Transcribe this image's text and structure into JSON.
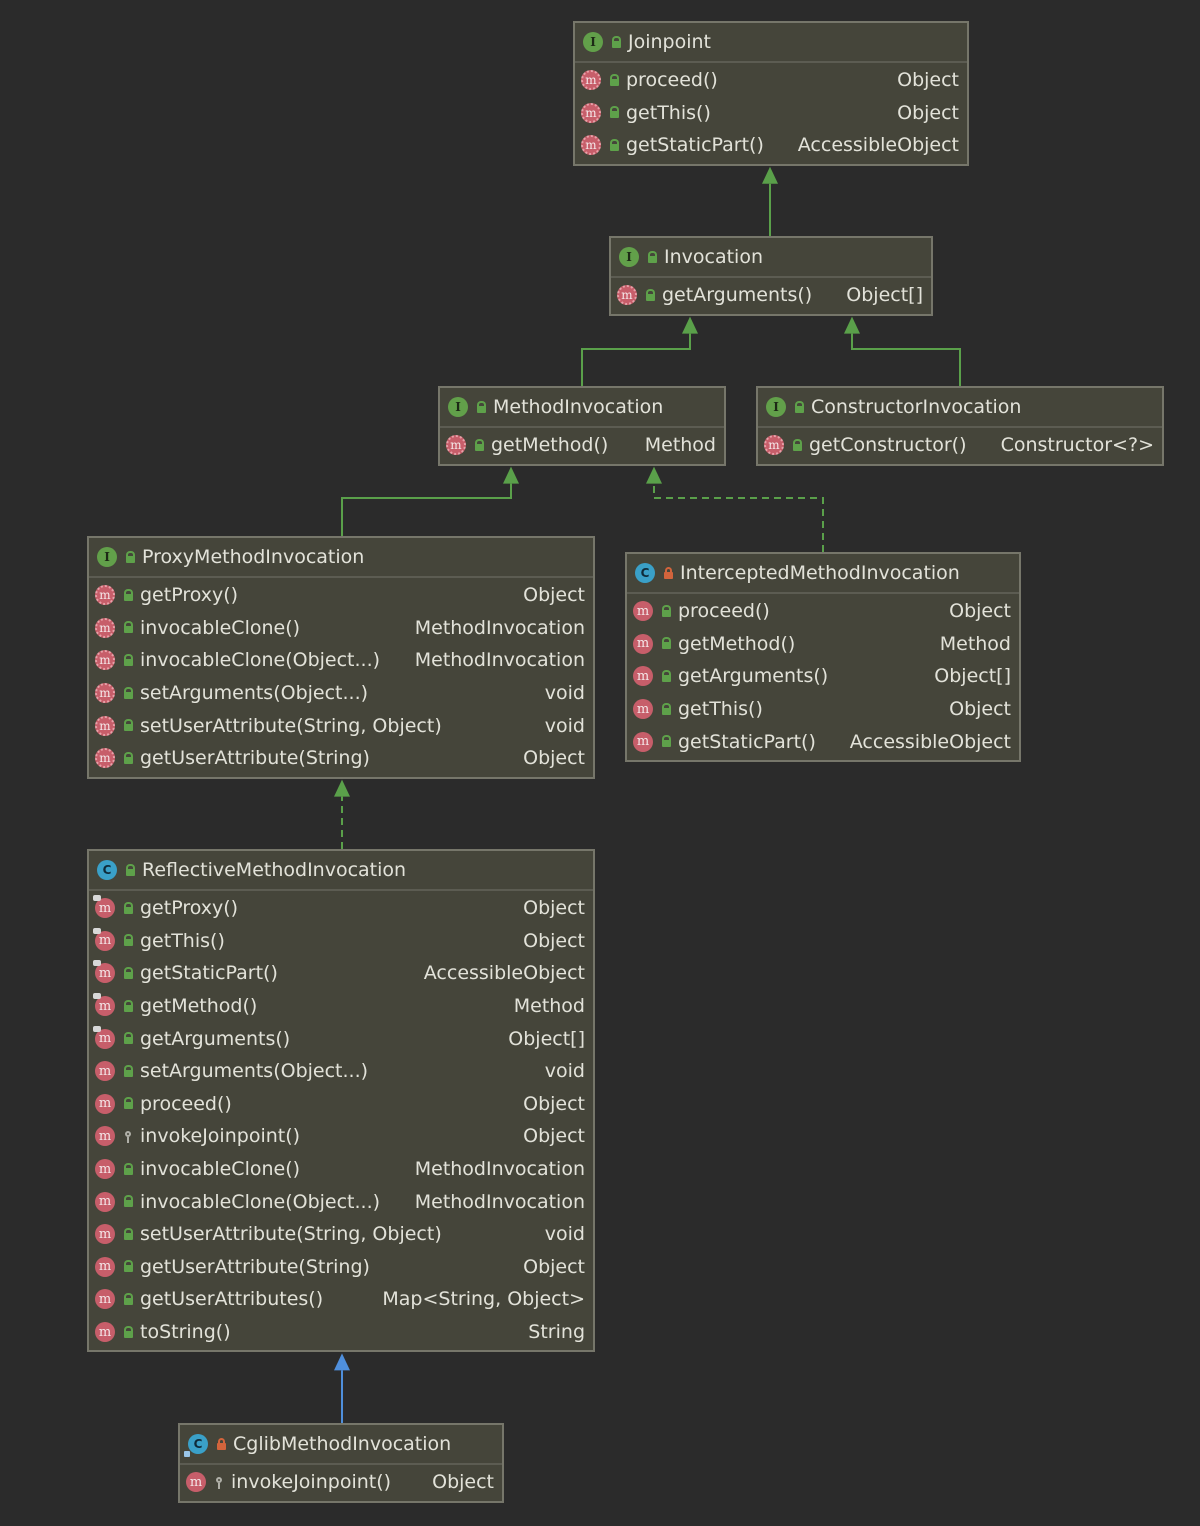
{
  "diagram": {
    "nodes": [
      {
        "id": "joinpoint",
        "name": "Joinpoint",
        "kind": "interface",
        "visibility": "public",
        "members": [
          {
            "name": "proceed()",
            "type": "Object",
            "kind": "abstract",
            "visibility": "public"
          },
          {
            "name": "getThis()",
            "type": "Object",
            "kind": "abstract",
            "visibility": "public"
          },
          {
            "name": "getStaticPart()",
            "type": "AccessibleObject",
            "kind": "abstract",
            "visibility": "public"
          }
        ]
      },
      {
        "id": "invocation",
        "name": "Invocation",
        "kind": "interface",
        "visibility": "public",
        "members": [
          {
            "name": "getArguments()",
            "type": "Object[]",
            "kind": "abstract",
            "visibility": "public"
          }
        ]
      },
      {
        "id": "methodinvocation",
        "name": "MethodInvocation",
        "kind": "interface",
        "visibility": "public",
        "members": [
          {
            "name": "getMethod()",
            "type": "Method",
            "kind": "abstract",
            "visibility": "public"
          }
        ]
      },
      {
        "id": "constructorinvocation",
        "name": "ConstructorInvocation",
        "kind": "interface",
        "visibility": "public",
        "members": [
          {
            "name": "getConstructor()",
            "type": "Constructor<?>",
            "kind": "abstract",
            "visibility": "public"
          }
        ]
      },
      {
        "id": "proxymethodinvocation",
        "name": "ProxyMethodInvocation",
        "kind": "interface",
        "visibility": "public",
        "members": [
          {
            "name": "getProxy()",
            "type": "Object",
            "kind": "abstract",
            "visibility": "public"
          },
          {
            "name": "invocableClone()",
            "type": "MethodInvocation",
            "kind": "abstract",
            "visibility": "public"
          },
          {
            "name": "invocableClone(Object...)",
            "type": "MethodInvocation",
            "kind": "abstract",
            "visibility": "public"
          },
          {
            "name": "setArguments(Object...)",
            "type": "void",
            "kind": "abstract",
            "visibility": "public"
          },
          {
            "name": "setUserAttribute(String, Object)",
            "type": "void",
            "kind": "abstract",
            "visibility": "public"
          },
          {
            "name": "getUserAttribute(String)",
            "type": "Object",
            "kind": "abstract",
            "visibility": "public"
          }
        ]
      },
      {
        "id": "interceptedmethodinvocation",
        "name": "InterceptedMethodInvocation",
        "kind": "class",
        "visibility": "private",
        "members": [
          {
            "name": "proceed()",
            "type": "Object",
            "kind": "method",
            "visibility": "public"
          },
          {
            "name": "getMethod()",
            "type": "Method",
            "kind": "method",
            "visibility": "public"
          },
          {
            "name": "getArguments()",
            "type": "Object[]",
            "kind": "method",
            "visibility": "public"
          },
          {
            "name": "getThis()",
            "type": "Object",
            "kind": "method",
            "visibility": "public"
          },
          {
            "name": "getStaticPart()",
            "type": "AccessibleObject",
            "kind": "method",
            "visibility": "public"
          }
        ]
      },
      {
        "id": "reflectivemethodinvocation",
        "name": "ReflectiveMethodInvocation",
        "kind": "class",
        "visibility": "public",
        "members": [
          {
            "name": "getProxy()",
            "type": "Object",
            "kind": "override",
            "visibility": "public"
          },
          {
            "name": "getThis()",
            "type": "Object",
            "kind": "override",
            "visibility": "public"
          },
          {
            "name": "getStaticPart()",
            "type": "AccessibleObject",
            "kind": "override",
            "visibility": "public"
          },
          {
            "name": "getMethod()",
            "type": "Method",
            "kind": "override",
            "visibility": "public"
          },
          {
            "name": "getArguments()",
            "type": "Object[]",
            "kind": "override",
            "visibility": "public"
          },
          {
            "name": "setArguments(Object...)",
            "type": "void",
            "kind": "method",
            "visibility": "public"
          },
          {
            "name": "proceed()",
            "type": "Object",
            "kind": "method",
            "visibility": "public"
          },
          {
            "name": "invokeJoinpoint()",
            "type": "Object",
            "kind": "method",
            "visibility": "package"
          },
          {
            "name": "invocableClone()",
            "type": "MethodInvocation",
            "kind": "method",
            "visibility": "public"
          },
          {
            "name": "invocableClone(Object...)",
            "type": "MethodInvocation",
            "kind": "method",
            "visibility": "public"
          },
          {
            "name": "setUserAttribute(String, Object)",
            "type": "void",
            "kind": "method",
            "visibility": "public"
          },
          {
            "name": "getUserAttribute(String)",
            "type": "Object",
            "kind": "method",
            "visibility": "public"
          },
          {
            "name": "getUserAttributes()",
            "type": "Map<String, Object>",
            "kind": "method",
            "visibility": "public"
          },
          {
            "name": "toString()",
            "type": "String",
            "kind": "method",
            "visibility": "public"
          }
        ]
      },
      {
        "id": "cglibmethodinvocation",
        "name": "CglibMethodInvocation",
        "kind": "class",
        "class_modifier": "abstract-mark",
        "visibility": "private",
        "members": [
          {
            "name": "invokeJoinpoint()",
            "type": "Object",
            "kind": "method",
            "visibility": "package"
          }
        ]
      }
    ],
    "edges": [
      {
        "from": "invocation",
        "to": "joinpoint",
        "type": "extends"
      },
      {
        "from": "methodinvocation",
        "to": "invocation",
        "type": "extends"
      },
      {
        "from": "constructorinvocation",
        "to": "invocation",
        "type": "extends"
      },
      {
        "from": "proxymethodinvocation",
        "to": "methodinvocation",
        "type": "extends"
      },
      {
        "from": "interceptedmethodinvocation",
        "to": "methodinvocation",
        "type": "implements"
      },
      {
        "from": "reflectivemethodinvocation",
        "to": "proxymethodinvocation",
        "type": "implements"
      },
      {
        "from": "cglibmethodinvocation",
        "to": "reflectivemethodinvocation",
        "type": "class-extends"
      }
    ],
    "colors": {
      "background": "#2b2b2b",
      "node_fill": "#45453a",
      "interface_edge": "#5aa04a",
      "class_edge": "#4f8fdc"
    }
  }
}
